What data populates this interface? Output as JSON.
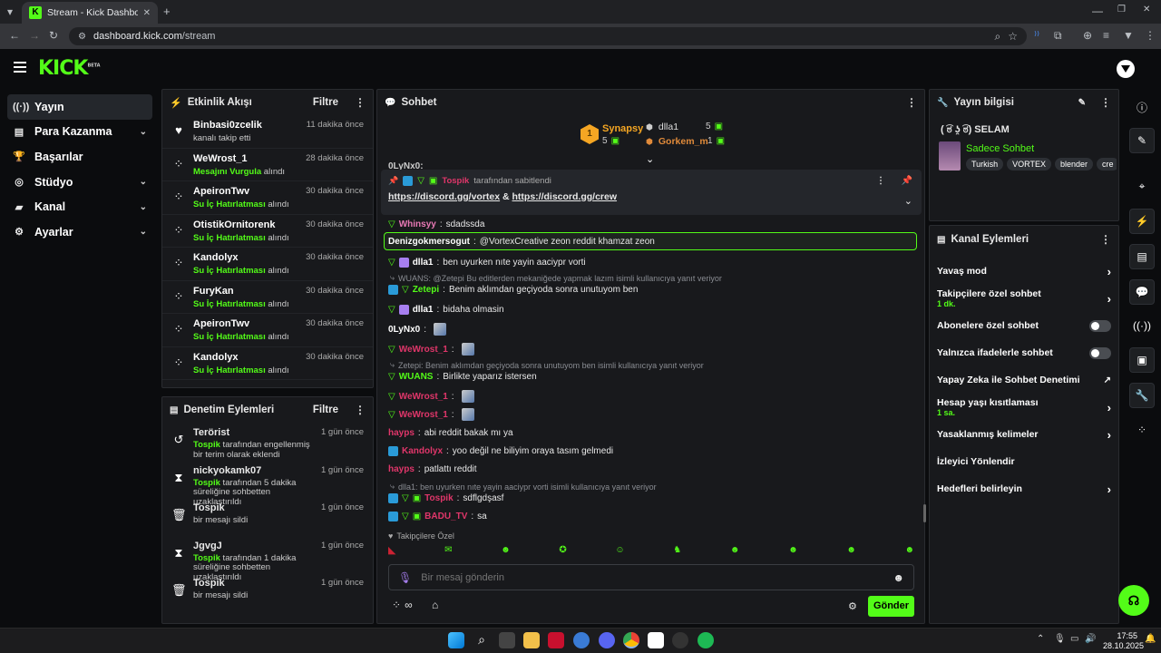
{
  "browser": {
    "tab_title": "Stream - Kick Dashboard",
    "url_host": "dashboard.kick.com",
    "url_path": "/stream",
    "new_tab": "+"
  },
  "app": {
    "logo": "KICK",
    "logo_tag": "BETA"
  },
  "nav": [
    {
      "label": "Yayın",
      "icon": "broadcast-icon",
      "glyph": "((·))",
      "chevron": false
    },
    {
      "label": "Para Kazanma",
      "icon": "money-icon",
      "glyph": "▤",
      "chevron": true
    },
    {
      "label": "Başarılar",
      "icon": "trophy-icon",
      "glyph": "🏆",
      "chevron": false
    },
    {
      "label": "Stüdyo",
      "icon": "studio-icon",
      "glyph": "◎",
      "chevron": true
    },
    {
      "label": "Kanal",
      "icon": "channel-icon",
      "glyph": "▰",
      "chevron": true
    },
    {
      "label": "Ayarlar",
      "icon": "gear-icon",
      "glyph": "⚙",
      "chevron": true
    }
  ],
  "activity": {
    "title": "Etkinlik Akışı",
    "filter": "Filtre",
    "items": [
      {
        "name": "Binbasi0zcelik",
        "desc_pre": "kanalı takip etti",
        "highlight": "",
        "desc_post": "",
        "time": "11 dakika önce",
        "icon": "heart-icon",
        "glyph": "♥"
      },
      {
        "name": "WeWrost_1",
        "desc_pre": "",
        "highlight": "Mesajını Vurgula",
        "desc_post": " alındı",
        "time": "28 dakika önce",
        "icon": "kick-points-icon",
        "glyph": "⁘"
      },
      {
        "name": "ApeironTwv",
        "desc_pre": "",
        "highlight": "Su İç Hatırlatması",
        "desc_post": " alındı",
        "time": "30 dakika önce",
        "icon": "kick-points-icon",
        "glyph": "⁘"
      },
      {
        "name": "OtistikOrnitorenk",
        "desc_pre": "",
        "highlight": "Su İç Hatırlatması",
        "desc_post": " alındı",
        "time": "30 dakika önce",
        "icon": "kick-points-icon",
        "glyph": "⁘"
      },
      {
        "name": "Kandolyx",
        "desc_pre": "",
        "highlight": "Su İç Hatırlatması",
        "desc_post": " alındı",
        "time": "30 dakika önce",
        "icon": "kick-points-icon",
        "glyph": "⁘"
      },
      {
        "name": "FuryKan",
        "desc_pre": "",
        "highlight": "Su İç Hatırlatması",
        "desc_post": " alındı",
        "time": "30 dakika önce",
        "icon": "kick-points-icon",
        "glyph": "⁘"
      },
      {
        "name": "ApeironTwv",
        "desc_pre": "",
        "highlight": "Su İç Hatırlatması",
        "desc_post": " alındı",
        "time": "30 dakika önce",
        "icon": "kick-points-icon",
        "glyph": "⁘"
      },
      {
        "name": "Kandolyx",
        "desc_pre": "",
        "highlight": "Su İç Hatırlatması",
        "desc_post": " alındı",
        "time": "30 dakika önce",
        "icon": "kick-points-icon",
        "glyph": "⁘"
      }
    ]
  },
  "moderation": {
    "title": "Denetim Eylemleri",
    "filter": "Filtre",
    "items": [
      {
        "name": "Terörist",
        "actor": "Tospik",
        "desc": " tarafından engellenmiş bir terim olarak eklendi",
        "time": "1 gün önce",
        "icon": "undo-icon",
        "glyph": "↺"
      },
      {
        "name": "nickyokamk07",
        "actor": "Tospik",
        "desc": " tarafından 5 dakika süreliğine sohbetten uzaklaştırıldı",
        "time": "1 gün önce",
        "icon": "hourglass-icon",
        "glyph": "⧗"
      },
      {
        "name": "Tospik",
        "actor": "",
        "desc": "bir mesajı sildi",
        "time": "1 gün önce",
        "icon": "trash-icon",
        "glyph": "🗑"
      },
      {
        "name": "JgvgJ",
        "actor": "Tospik",
        "desc": " tarafından 1 dakika süreliğine sohbetten uzaklaştırıldı",
        "time": "1 gün önce",
        "icon": "hourglass-icon",
        "glyph": "⧗"
      },
      {
        "name": "Tospik",
        "actor": "",
        "desc": "bir mesajı sildi",
        "time": "1 gün önce",
        "icon": "trash-icon",
        "glyph": "🗑"
      }
    ]
  },
  "chat": {
    "title": "Sohbet",
    "leaderboard": {
      "first_rank": "1",
      "first_name": "Synapsy",
      "first_count": "5",
      "second_name": "dlla1",
      "second_count": "5",
      "third_name": "Gorkem_m",
      "third_count": "1"
    },
    "cut_user": "0LyNx0:",
    "pinned": {
      "by_user": "Tospik",
      "by_text": "tarafından sabitlendi",
      "link1": "https://discord.gg/vortex",
      "amp": " & ",
      "link2": "https://discord.gg/crew"
    },
    "messages": [
      {
        "reply": "",
        "user": "Whinsyy",
        "ucls": "u-pink",
        "text": "sdadssda",
        "badges": [
          "green-v"
        ]
      },
      {
        "reply": "",
        "user": "Denizgokmersogut",
        "ucls": "u-white",
        "text": "@VortexCreative zeon reddit khamzat zeon",
        "badges": [],
        "highlight": true
      },
      {
        "reply": "",
        "user": "dlla1",
        "ucls": "u-white",
        "text": "ben uyurken nıte yayin aaciypr vorti",
        "badges": [
          "green-v",
          "purple"
        ]
      },
      {
        "reply": "WUANS: @Zetepi Bu editlerden mekaniğede yapmak lazım isimli kullanıcıya yanıt veriyor",
        "user": "Zetepi",
        "ucls": "u-green",
        "text": "Benim aklımdan geçiyoda sonra unutuyom ben",
        "badges": [
          "blue",
          "green-v"
        ]
      },
      {
        "reply": "",
        "user": "dlla1",
        "ucls": "u-white",
        "text": "bidaha olmasin",
        "badges": [
          "green-v",
          "purple"
        ]
      },
      {
        "reply": "",
        "user": "0LyNx0",
        "ucls": "u-white",
        "text": "",
        "badges": [],
        "emote": true
      },
      {
        "reply": "",
        "user": "WeWrost_1",
        "ucls": "u-red",
        "text": "",
        "badges": [
          "green-v"
        ],
        "emote": true
      },
      {
        "reply": "Zetepi: Benim aklımdan geçiyoda sonra unutuyom ben isimli kullanıcıya yanıt veriyor",
        "user": "WUANS",
        "ucls": "u-green",
        "text": "Birlikte yaparız istersen",
        "badges": [
          "green-v"
        ]
      },
      {
        "reply": "",
        "user": "WeWrost_1",
        "ucls": "u-red",
        "text": "",
        "badges": [
          "green-v"
        ],
        "emote": true
      },
      {
        "reply": "",
        "user": "WeWrost_1",
        "ucls": "u-red",
        "text": "",
        "badges": [
          "green-v"
        ],
        "emote": true
      },
      {
        "reply": "",
        "user": "hayps",
        "ucls": "u-red",
        "text": "abi reddit bakak mı ya",
        "badges": []
      },
      {
        "reply": "",
        "user": "Kandolyx",
        "ucls": "u-red",
        "text": "yoo değil ne biliyim oraya tasım gelmedi",
        "badges": [
          "blue"
        ]
      },
      {
        "reply": "",
        "user": "hayps",
        "ucls": "u-red",
        "text": "patlattı reddit",
        "badges": []
      },
      {
        "reply": "dlla1: ben uyurken nıte yayin aaciypr vorti isimli kullanıcıya yanıt veriyor",
        "user": "Tospik",
        "ucls": "u-red",
        "text": "sdflgdşasf",
        "badges": [
          "blue",
          "green-v",
          "green-s"
        ]
      },
      {
        "reply": "",
        "user": "BADU_TV",
        "ucls": "u-red",
        "text": "sa",
        "badges": [
          "blue",
          "green-v",
          "green-s"
        ]
      }
    ],
    "followers_only": "Takipçilere Özel",
    "input_placeholder": "Bir mesaj gönderin",
    "send_label": "Gönder"
  },
  "stream_info": {
    "title": "Yayın bilgisi",
    "stream_title": "( ͡ಠ ʖ̯ ͡ಠ) SELAM",
    "category": "Sadece Sohbet",
    "tags": [
      "Turkish",
      "VORTEX",
      "blender",
      "cre"
    ]
  },
  "channel_actions": {
    "title": "Kanal Eylemleri",
    "items": [
      {
        "label": "Yavaş mod",
        "sub": "",
        "control": "chevron"
      },
      {
        "label": "Takipçilere özel sohbet",
        "sub": "1 dk.",
        "control": "chevron"
      },
      {
        "label": "Abonelere özel sohbet",
        "sub": "",
        "control": "toggle"
      },
      {
        "label": "Yalnızca ifadelerle sohbet",
        "sub": "",
        "control": "toggle"
      },
      {
        "label": "Yapay Zeka ile Sohbet Denetimi",
        "sub": "",
        "control": "external"
      },
      {
        "label": "Hesap yaşı kısıtlaması",
        "sub": "1 sa.",
        "control": "chevron"
      },
      {
        "label": "Yasaklanmış kelimeler",
        "sub": "",
        "control": "chevron"
      },
      {
        "label": "İzleyici Yönlendir",
        "sub": "",
        "control": "none"
      },
      {
        "label": "Hedefleri belirleyin",
        "sub": "",
        "control": "chevron"
      }
    ]
  },
  "taskbar": {
    "time": "17:55",
    "date": "28.10.2025"
  },
  "colors": {
    "brand": "#53fc18",
    "panel": "#18191c",
    "username_red": "#e0366a",
    "link_blue": "#2a9bd8"
  }
}
